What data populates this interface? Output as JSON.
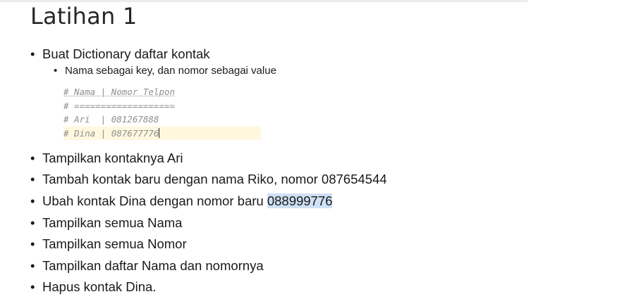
{
  "slide": {
    "title": "Latihan 1",
    "bullet_char": "•",
    "items": [
      {
        "text": "Buat Dictionary daftar kontak"
      },
      {
        "text": "Tampilkan kontaknya Ari"
      },
      {
        "text": "Tambah kontak baru dengan nama Riko, nomor 087654544"
      },
      {
        "text_before": "Ubah kontak Dina dengan nomor baru ",
        "text_selected": "088999776"
      },
      {
        "text": "Tampilkan semua Nama"
      },
      {
        "text": "Tampilkan semua Nomor"
      },
      {
        "text": "Tampilkan daftar Nama dan nomornya"
      },
      {
        "text": "Hapus kontak Dina."
      }
    ],
    "sub_item": "Nama sebagai key, dan nomor sebagai value",
    "code_lines": [
      "# Nama | Nomor Telpon",
      "# ===================",
      "# Ari  | 081267888",
      "# Dina | 087677776"
    ]
  },
  "colors": {
    "selection": "#cfe0f5",
    "active_line": "#fff8df",
    "code_text": "#8e8e8e"
  }
}
